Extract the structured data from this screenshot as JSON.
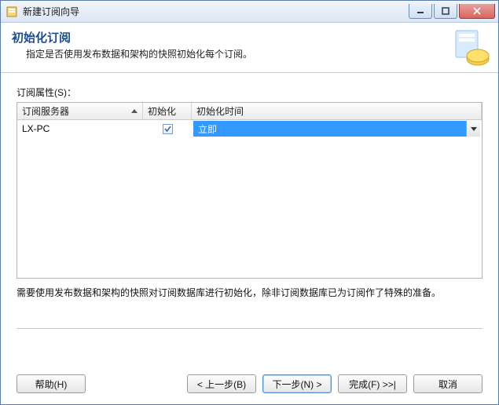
{
  "window": {
    "title": "新建订阅向导"
  },
  "header": {
    "title": "初始化订阅",
    "subtitle": "指定是否使用发布数据和架构的快照初始化每个订阅。"
  },
  "section": {
    "properties_label": "订阅属性(S)："
  },
  "grid": {
    "columns": {
      "server": "订阅服务器",
      "init": "初始化",
      "init_time": "初始化时间"
    },
    "rows": [
      {
        "server": "LX-PC",
        "init_checked": true,
        "init_time": "立即"
      }
    ]
  },
  "note": "需要使用发布数据和架构的快照对订阅数据库进行初始化，除非订阅数据库已为订阅作了特殊的准备。",
  "footer": {
    "help": "帮助(H)",
    "back": "< 上一步(B)",
    "next": "下一步(N) >",
    "finish": "完成(F) >>|",
    "cancel": "取消"
  }
}
